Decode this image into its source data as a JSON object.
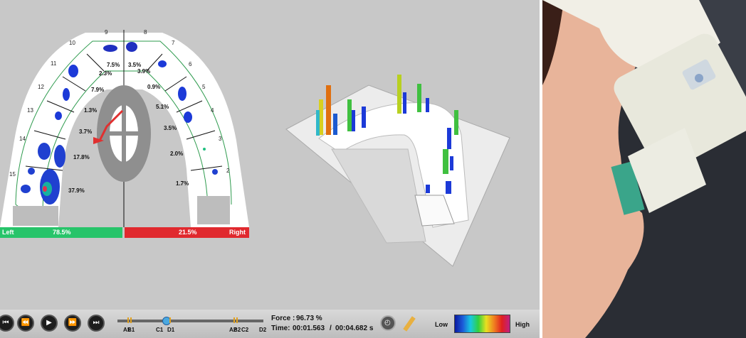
{
  "tooth_numbers": [
    "9",
    "8",
    "10",
    "7",
    "11",
    "6",
    "12",
    "5",
    "13",
    "4",
    "14",
    "3",
    "15",
    "2"
  ],
  "percentages": [
    "7.5%",
    "3.5%",
    "2.3%",
    "3.9%",
    "7.9%",
    "0.9%",
    "1.3%",
    "5.1%",
    "3.7%",
    "3.5%",
    "17.8%",
    "2.0%",
    "37.9%",
    "1.7%"
  ],
  "balance": {
    "left_label": "Left",
    "left_value": "78.5%",
    "right_value": "21.5%",
    "right_label": "Right",
    "left_color": "#27c46a",
    "right_color": "#e0292e"
  },
  "markers": [
    "A1",
    "B1",
    "C1",
    "D1",
    "A2",
    "B2",
    "C2",
    "D2"
  ],
  "playback_progress": 0.33,
  "force": {
    "label": "Force :",
    "value": "96.73 %"
  },
  "time": {
    "label": "Time:",
    "current": "00:01.563",
    "separator": "/",
    "total": "00:04.682 s"
  },
  "legend": {
    "low": "Low",
    "high": "High"
  },
  "icons": {
    "first": "skip-first-icon",
    "prev": "rewind-icon",
    "play": "play-icon",
    "next": "fast-forward-icon",
    "last": "skip-last-icon",
    "settings": "dial-icon",
    "ruler": "ruler-icon"
  }
}
